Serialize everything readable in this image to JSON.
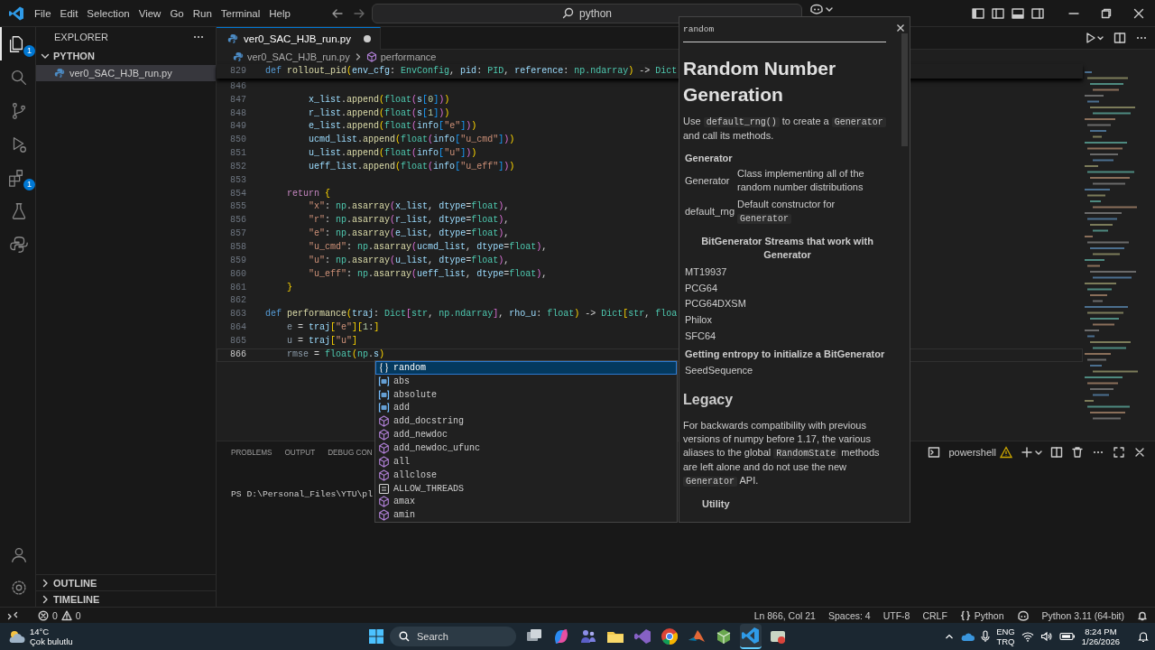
{
  "title_bar": {
    "menu": [
      "File",
      "Edit",
      "Selection",
      "View",
      "Go",
      "Run",
      "Terminal",
      "Help"
    ],
    "command_center": "python"
  },
  "activity_bar": {
    "items": [
      {
        "kind": "explorer",
        "selected": true,
        "badge": "1"
      },
      {
        "kind": "search",
        "selected": false
      },
      {
        "kind": "source-control",
        "selected": false
      },
      {
        "kind": "run-debug",
        "selected": false
      },
      {
        "kind": "extensions",
        "selected": false,
        "badge": "1"
      },
      {
        "kind": "testing",
        "selected": false
      },
      {
        "kind": "python",
        "selected": false
      }
    ],
    "bottom": [
      {
        "kind": "account"
      },
      {
        "kind": "settings"
      }
    ]
  },
  "sidebar": {
    "title": "EXPLORER",
    "folder": {
      "name": "PYTHON",
      "expanded": true,
      "files": [
        {
          "name": "ver0_SAC_HJB_run.py",
          "selected": true
        }
      ]
    },
    "sections": [
      {
        "name": "OUTLINE",
        "expanded": false
      },
      {
        "name": "TIMELINE",
        "expanded": false
      }
    ]
  },
  "editor": {
    "tabs": [
      {
        "label": "ver0_SAC_HJB_run.py",
        "selected": true,
        "modified": true
      }
    ],
    "breadcrumb": [
      "ver0_SAC_HJB_run.py",
      "performance"
    ],
    "sticky_line": {
      "number": "829",
      "tokens": [
        {
          "text": "def ",
          "kind": "kw"
        },
        {
          "text": "rollout_pid",
          "kind": "fn"
        },
        {
          "text": "(",
          "kind": "b1"
        },
        {
          "text": "env_cfg",
          "kind": "var"
        },
        {
          "text": ": ",
          "kind": "p"
        },
        {
          "text": "EnvConfig",
          "kind": "type"
        },
        {
          "text": ", ",
          "kind": "p"
        },
        {
          "text": "pid",
          "kind": "var"
        },
        {
          "text": ": ",
          "kind": "p"
        },
        {
          "text": "PID",
          "kind": "type"
        },
        {
          "text": ", ",
          "kind": "p"
        },
        {
          "text": "reference",
          "kind": "var"
        },
        {
          "text": ": ",
          "kind": "p"
        },
        {
          "text": "np.ndarray",
          "kind": "type"
        },
        {
          "text": ")",
          "kind": "b1"
        },
        {
          "text": " -> ",
          "kind": "p"
        },
        {
          "text": "Dict",
          "kind": "type"
        }
      ]
    },
    "lines": [
      {
        "number": "846",
        "current": false
      },
      {
        "number": "847",
        "current": false,
        "tokens": [
          {
            "text": "        x_list",
            "kind": "var"
          },
          {
            "text": ".",
            "kind": "p"
          },
          {
            "text": "append",
            "kind": "fn"
          },
          {
            "text": "(",
            "kind": "b1"
          },
          {
            "text": "float",
            "kind": "type"
          },
          {
            "text": "(",
            "kind": "b2"
          },
          {
            "text": "s",
            "kind": "var"
          },
          {
            "text": "[",
            "kind": "b3"
          },
          {
            "text": "0",
            "kind": "num"
          },
          {
            "text": "]",
            "kind": "b3"
          },
          {
            "text": ")",
            "kind": "b2"
          },
          {
            "text": ")",
            "kind": "b1"
          }
        ]
      },
      {
        "number": "848",
        "current": false,
        "tokens": [
          {
            "text": "        r_list",
            "kind": "var"
          },
          {
            "text": ".",
            "kind": "p"
          },
          {
            "text": "append",
            "kind": "fn"
          },
          {
            "text": "(",
            "kind": "b1"
          },
          {
            "text": "float",
            "kind": "type"
          },
          {
            "text": "(",
            "kind": "b2"
          },
          {
            "text": "s",
            "kind": "var"
          },
          {
            "text": "[",
            "kind": "b3"
          },
          {
            "text": "1",
            "kind": "num"
          },
          {
            "text": "]",
            "kind": "b3"
          },
          {
            "text": ")",
            "kind": "b2"
          },
          {
            "text": ")",
            "kind": "b1"
          }
        ]
      },
      {
        "number": "849",
        "current": false,
        "tokens": [
          {
            "text": "        e_list",
            "kind": "var"
          },
          {
            "text": ".",
            "kind": "p"
          },
          {
            "text": "append",
            "kind": "fn"
          },
          {
            "text": "(",
            "kind": "b1"
          },
          {
            "text": "float",
            "kind": "type"
          },
          {
            "text": "(",
            "kind": "b2"
          },
          {
            "text": "info",
            "kind": "var"
          },
          {
            "text": "[",
            "kind": "b3"
          },
          {
            "text": "\"e\"",
            "kind": "str"
          },
          {
            "text": "]",
            "kind": "b3"
          },
          {
            "text": ")",
            "kind": "b2"
          },
          {
            "text": ")",
            "kind": "b1"
          }
        ]
      },
      {
        "number": "850",
        "current": false,
        "tokens": [
          {
            "text": "        ucmd_list",
            "kind": "var"
          },
          {
            "text": ".",
            "kind": "p"
          },
          {
            "text": "append",
            "kind": "fn"
          },
          {
            "text": "(",
            "kind": "b1"
          },
          {
            "text": "float",
            "kind": "type"
          },
          {
            "text": "(",
            "kind": "b2"
          },
          {
            "text": "info",
            "kind": "var"
          },
          {
            "text": "[",
            "kind": "b3"
          },
          {
            "text": "\"u_cmd\"",
            "kind": "str"
          },
          {
            "text": "]",
            "kind": "b3"
          },
          {
            "text": ")",
            "kind": "b2"
          },
          {
            "text": ")",
            "kind": "b1"
          }
        ]
      },
      {
        "number": "851",
        "current": false,
        "tokens": [
          {
            "text": "        u_list",
            "kind": "var"
          },
          {
            "text": ".",
            "kind": "p"
          },
          {
            "text": "append",
            "kind": "fn"
          },
          {
            "text": "(",
            "kind": "b1"
          },
          {
            "text": "float",
            "kind": "type"
          },
          {
            "text": "(",
            "kind": "b2"
          },
          {
            "text": "info",
            "kind": "var"
          },
          {
            "text": "[",
            "kind": "b3"
          },
          {
            "text": "\"u\"",
            "kind": "str"
          },
          {
            "text": "]",
            "kind": "b3"
          },
          {
            "text": ")",
            "kind": "b2"
          },
          {
            "text": ")",
            "kind": "b1"
          }
        ]
      },
      {
        "number": "852",
        "current": false,
        "tokens": [
          {
            "text": "        ueff_list",
            "kind": "var"
          },
          {
            "text": ".",
            "kind": "p"
          },
          {
            "text": "append",
            "kind": "fn"
          },
          {
            "text": "(",
            "kind": "b1"
          },
          {
            "text": "float",
            "kind": "type"
          },
          {
            "text": "(",
            "kind": "b2"
          },
          {
            "text": "info",
            "kind": "var"
          },
          {
            "text": "[",
            "kind": "b3"
          },
          {
            "text": "\"u_eff\"",
            "kind": "str"
          },
          {
            "text": "]",
            "kind": "b3"
          },
          {
            "text": ")",
            "kind": "b2"
          },
          {
            "text": ")",
            "kind": "b1"
          }
        ]
      },
      {
        "number": "853",
        "current": false
      },
      {
        "number": "854",
        "current": false,
        "tokens": [
          {
            "text": "    return ",
            "kind": "ctl"
          },
          {
            "text": "{",
            "kind": "b1"
          }
        ]
      },
      {
        "number": "855",
        "current": false,
        "tokens": [
          {
            "text": "        \"x\"",
            "kind": "str"
          },
          {
            "text": ": ",
            "kind": "p"
          },
          {
            "text": "np",
            "kind": "type"
          },
          {
            "text": ".",
            "kind": "p"
          },
          {
            "text": "asarray",
            "kind": "fn"
          },
          {
            "text": "(",
            "kind": "b2"
          },
          {
            "text": "x_list",
            "kind": "var"
          },
          {
            "text": ", ",
            "kind": "p"
          },
          {
            "text": "dtype",
            "kind": "var"
          },
          {
            "text": "=",
            "kind": "p"
          },
          {
            "text": "float",
            "kind": "type"
          },
          {
            "text": ")",
            "kind": "b2"
          },
          {
            "text": ",",
            "kind": "p"
          }
        ]
      },
      {
        "number": "856",
        "current": false,
        "tokens": [
          {
            "text": "        \"r\"",
            "kind": "str"
          },
          {
            "text": ": ",
            "kind": "p"
          },
          {
            "text": "np",
            "kind": "type"
          },
          {
            "text": ".",
            "kind": "p"
          },
          {
            "text": "asarray",
            "kind": "fn"
          },
          {
            "text": "(",
            "kind": "b2"
          },
          {
            "text": "r_list",
            "kind": "var"
          },
          {
            "text": ", ",
            "kind": "p"
          },
          {
            "text": "dtype",
            "kind": "var"
          },
          {
            "text": "=",
            "kind": "p"
          },
          {
            "text": "float",
            "kind": "type"
          },
          {
            "text": ")",
            "kind": "b2"
          },
          {
            "text": ",",
            "kind": "p"
          }
        ]
      },
      {
        "number": "857",
        "current": false,
        "tokens": [
          {
            "text": "        \"e\"",
            "kind": "str"
          },
          {
            "text": ": ",
            "kind": "p"
          },
          {
            "text": "np",
            "kind": "type"
          },
          {
            "text": ".",
            "kind": "p"
          },
          {
            "text": "asarray",
            "kind": "fn"
          },
          {
            "text": "(",
            "kind": "b2"
          },
          {
            "text": "e_list",
            "kind": "var"
          },
          {
            "text": ", ",
            "kind": "p"
          },
          {
            "text": "dtype",
            "kind": "var"
          },
          {
            "text": "=",
            "kind": "p"
          },
          {
            "text": "float",
            "kind": "type"
          },
          {
            "text": ")",
            "kind": "b2"
          },
          {
            "text": ",",
            "kind": "p"
          }
        ]
      },
      {
        "number": "858",
        "current": false,
        "tokens": [
          {
            "text": "        \"u_cmd\"",
            "kind": "str"
          },
          {
            "text": ": ",
            "kind": "p"
          },
          {
            "text": "np",
            "kind": "type"
          },
          {
            "text": ".",
            "kind": "p"
          },
          {
            "text": "asarray",
            "kind": "fn"
          },
          {
            "text": "(",
            "kind": "b2"
          },
          {
            "text": "ucmd_list",
            "kind": "var"
          },
          {
            "text": ", ",
            "kind": "p"
          },
          {
            "text": "dtype",
            "kind": "var"
          },
          {
            "text": "=",
            "kind": "p"
          },
          {
            "text": "float",
            "kind": "type"
          },
          {
            "text": ")",
            "kind": "b2"
          },
          {
            "text": ",",
            "kind": "p"
          }
        ]
      },
      {
        "number": "859",
        "current": false,
        "tokens": [
          {
            "text": "        \"u\"",
            "kind": "str"
          },
          {
            "text": ": ",
            "kind": "p"
          },
          {
            "text": "np",
            "kind": "type"
          },
          {
            "text": ".",
            "kind": "p"
          },
          {
            "text": "asarray",
            "kind": "fn"
          },
          {
            "text": "(",
            "kind": "b2"
          },
          {
            "text": "u_list",
            "kind": "var"
          },
          {
            "text": ", ",
            "kind": "p"
          },
          {
            "text": "dtype",
            "kind": "var"
          },
          {
            "text": "=",
            "kind": "p"
          },
          {
            "text": "float",
            "kind": "type"
          },
          {
            "text": ")",
            "kind": "b2"
          },
          {
            "text": ",",
            "kind": "p"
          }
        ]
      },
      {
        "number": "860",
        "current": false,
        "tokens": [
          {
            "text": "        \"u_eff\"",
            "kind": "str"
          },
          {
            "text": ": ",
            "kind": "p"
          },
          {
            "text": "np",
            "kind": "type"
          },
          {
            "text": ".",
            "kind": "p"
          },
          {
            "text": "asarray",
            "kind": "fn"
          },
          {
            "text": "(",
            "kind": "b2"
          },
          {
            "text": "ueff_list",
            "kind": "var"
          },
          {
            "text": ", ",
            "kind": "p"
          },
          {
            "text": "dtype",
            "kind": "var"
          },
          {
            "text": "=",
            "kind": "p"
          },
          {
            "text": "float",
            "kind": "type"
          },
          {
            "text": ")",
            "kind": "b2"
          },
          {
            "text": ",",
            "kind": "p"
          }
        ]
      },
      {
        "number": "861",
        "current": false,
        "tokens": [
          {
            "text": "    }",
            "kind": "b1"
          }
        ]
      },
      {
        "number": "862",
        "current": false
      },
      {
        "number": "863",
        "current": false,
        "tokens": [
          {
            "text": "def ",
            "kind": "kw"
          },
          {
            "text": "performance",
            "kind": "fn"
          },
          {
            "text": "(",
            "kind": "b1"
          },
          {
            "text": "traj",
            "kind": "var"
          },
          {
            "text": ": ",
            "kind": "p"
          },
          {
            "text": "Dict",
            "kind": "type"
          },
          {
            "text": "[",
            "kind": "b2"
          },
          {
            "text": "str",
            "kind": "type"
          },
          {
            "text": ", ",
            "kind": "p"
          },
          {
            "text": "np.ndarray",
            "kind": "type"
          },
          {
            "text": "]",
            "kind": "b2"
          },
          {
            "text": ", ",
            "kind": "p"
          },
          {
            "text": "rho_u",
            "kind": "var"
          },
          {
            "text": ": ",
            "kind": "p"
          },
          {
            "text": "float",
            "kind": "type"
          },
          {
            "text": ")",
            "kind": "b1"
          },
          {
            "text": " -> ",
            "kind": "p"
          },
          {
            "text": "Dict",
            "kind": "type"
          },
          {
            "text": "[",
            "kind": "b1"
          },
          {
            "text": "str",
            "kind": "type"
          },
          {
            "text": ", ",
            "kind": "p"
          },
          {
            "text": "floa",
            "kind": "type"
          }
        ]
      },
      {
        "number": "864",
        "current": false,
        "tokens": [
          {
            "text": "    e",
            "kind": "dim"
          },
          {
            "text": " = ",
            "kind": "p"
          },
          {
            "text": "traj",
            "kind": "var"
          },
          {
            "text": "[",
            "kind": "b1"
          },
          {
            "text": "\"e\"",
            "kind": "str"
          },
          {
            "text": "]",
            "kind": "b1"
          },
          {
            "text": "[",
            "kind": "b1"
          },
          {
            "text": "1",
            "kind": "num"
          },
          {
            "text": ":",
            "kind": "p"
          },
          {
            "text": "]",
            "kind": "b1"
          }
        ]
      },
      {
        "number": "865",
        "current": false,
        "tokens": [
          {
            "text": "    u",
            "kind": "dim"
          },
          {
            "text": " = ",
            "kind": "p"
          },
          {
            "text": "traj",
            "kind": "var"
          },
          {
            "text": "[",
            "kind": "b1"
          },
          {
            "text": "\"u\"",
            "kind": "str"
          },
          {
            "text": "]",
            "kind": "b1"
          }
        ]
      },
      {
        "number": "866",
        "current": true,
        "tokens": [
          {
            "text": "    rmse",
            "kind": "dim"
          },
          {
            "text": " = ",
            "kind": "p"
          },
          {
            "text": "float",
            "kind": "type"
          },
          {
            "text": "(",
            "kind": "b1"
          },
          {
            "text": "np",
            "kind": "type"
          },
          {
            "text": ".",
            "kind": "p"
          },
          {
            "text": "s",
            "kind": "var"
          },
          {
            "text": ")",
            "kind": "b1"
          }
        ]
      }
    ]
  },
  "suggest": {
    "items": [
      {
        "kind": "module",
        "label": "random",
        "selected": true
      },
      {
        "kind": "variable",
        "label": "abs",
        "selected": false
      },
      {
        "kind": "variable",
        "label": "absolute",
        "selected": false
      },
      {
        "kind": "variable",
        "label": "add",
        "selected": false
      },
      {
        "kind": "function",
        "label": "add_docstring",
        "selected": false
      },
      {
        "kind": "function",
        "label": "add_newdoc",
        "selected": false
      },
      {
        "kind": "function",
        "label": "add_newdoc_ufunc",
        "selected": false
      },
      {
        "kind": "function",
        "label": "all",
        "selected": false
      },
      {
        "kind": "function",
        "label": "allclose",
        "selected": false
      },
      {
        "kind": "constant",
        "label": "ALLOW_THREADS",
        "selected": false
      },
      {
        "kind": "function",
        "label": "amax",
        "selected": false
      },
      {
        "kind": "function",
        "label": "amin",
        "selected": false
      }
    ]
  },
  "hover": {
    "blocks": [
      {
        "kind": "title",
        "text": "random"
      },
      {
        "kind": "h1",
        "text": "Random Number Generation"
      },
      {
        "kind": "para",
        "parts": [
          {
            "text": "Use ",
            "kind": "text"
          },
          {
            "text": "default_rng()",
            "kind": "code"
          },
          {
            "text": " to create a ",
            "kind": "text"
          },
          {
            "text": "Generator",
            "kind": "code"
          },
          {
            "text": " and call its methods.",
            "kind": "text"
          }
        ]
      },
      {
        "kind": "th",
        "text": "Generator"
      },
      {
        "kind": "row",
        "name": "Generator",
        "parts": [
          {
            "text": "Class implementing all of the random number distributions",
            "kind": "text"
          }
        ]
      },
      {
        "kind": "row",
        "name": "default_rng",
        "parts": [
          {
            "text": "Default constructor for ",
            "kind": "text"
          },
          {
            "text": "Generator",
            "kind": "code"
          }
        ]
      },
      {
        "kind": "center",
        "text": "BitGenerator Streams that work with Generator"
      },
      {
        "kind": "item",
        "text": "MT19937"
      },
      {
        "kind": "item",
        "text": "PCG64"
      },
      {
        "kind": "item",
        "text": "PCG64DXSM"
      },
      {
        "kind": "item",
        "text": "Philox"
      },
      {
        "kind": "item",
        "text": "SFC64"
      },
      {
        "kind": "bold",
        "text": "Getting entropy to initialize a BitGenerator"
      },
      {
        "kind": "item",
        "text": "SeedSequence"
      },
      {
        "kind": "h2",
        "text": "Legacy"
      },
      {
        "kind": "para",
        "parts": [
          {
            "text": "For backwards compatibility with previous versions of numpy before 1.17, the various aliases to the global ",
            "kind": "text"
          },
          {
            "text": "RandomState",
            "kind": "code"
          },
          {
            "text": " methods are left alone and do not use the new ",
            "kind": "text"
          },
          {
            "text": "Generator",
            "kind": "code"
          },
          {
            "text": " API.",
            "kind": "text"
          }
        ]
      },
      {
        "kind": "subhead",
        "text": "Utility"
      }
    ]
  },
  "panel": {
    "tabs": [
      {
        "label": "PROBLEMS",
        "selected": false
      },
      {
        "label": "OUTPUT",
        "selected": false
      },
      {
        "label": "DEBUG CON",
        "selected": false
      }
    ],
    "terminal_lines": [
      "PS D:\\Personal_Files\\YTU\\pl"
    ],
    "terminal_name": "powershell"
  },
  "status_bar": {
    "errors": "0",
    "warnings": "0",
    "items": [
      "Ln 866, Col 21",
      "Spaces: 4",
      "UTF-8",
      "CRLF"
    ],
    "language": "Python",
    "interpreter": "Python 3.11 (64-bit)"
  },
  "taskbar": {
    "temperature": "14°C",
    "condition": "Çok bulutlu",
    "search": "Search",
    "apps": [
      {
        "kind": "task-view",
        "selected": false
      },
      {
        "kind": "copilot",
        "selected": false
      },
      {
        "kind": "teams",
        "selected": false
      },
      {
        "kind": "folder",
        "selected": false
      },
      {
        "kind": "visual-studio",
        "selected": false
      },
      {
        "kind": "browser",
        "selected": false
      },
      {
        "kind": "matlab",
        "selected": false
      },
      {
        "kind": "box",
        "selected": false
      },
      {
        "kind": "vscode",
        "selected": true
      },
      {
        "kind": "app",
        "selected": false
      }
    ],
    "language": [
      "ENG",
      "TRQ"
    ],
    "time": "8:24 PM",
    "date": "1/26/2026"
  }
}
